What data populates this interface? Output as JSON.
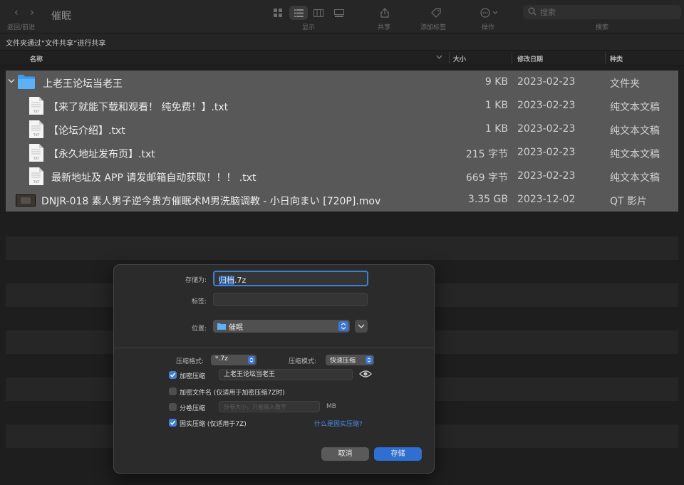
{
  "toolbar": {
    "back_forward_label": "返回/前进",
    "window_title": "催眠",
    "display_label": "显示",
    "share_label": "共享",
    "add_tag_label": "添加标签",
    "action_label": "操作",
    "search_placeholder": "搜索",
    "search_label": "搜索"
  },
  "share_bar": {
    "text": "文件夹通过“文件共享”进行共享"
  },
  "columns": {
    "name": "名称",
    "size": "大小",
    "date": "修改日期",
    "kind": "种类"
  },
  "files": [
    {
      "name": "上老王论坛当老王",
      "size": "9 KB",
      "date": "2023-02-23",
      "kind": "文件夹",
      "icon": "folder-icon",
      "expanded": true
    },
    {
      "name": "【来了就能下载和观看！ 纯免费！】.txt",
      "size": "1 KB",
      "date": "2023-02-23",
      "kind": "纯文本文稿",
      "icon": "txt-file-icon",
      "badge": "TXT"
    },
    {
      "name": "【论坛介绍】.txt",
      "size": "1 KB",
      "date": "2023-02-23",
      "kind": "纯文本文稿",
      "icon": "txt-file-icon",
      "badge": "TXT"
    },
    {
      "name": "【永久地址发布页】.txt",
      "size": "215 字节",
      "date": "2023-02-23",
      "kind": "纯文本文稿",
      "icon": "txt-file-icon",
      "badge": "TXT"
    },
    {
      "name": "最新地址及 APP 请发邮箱自动获取！！！ .txt",
      "size": "669 字节",
      "date": "2023-02-23",
      "kind": "纯文本文稿",
      "icon": "txt-file-icon",
      "badge": "TXT"
    },
    {
      "name": "DNJR-018 素人男子逆今贵方催眠术M男洗脑调教 - 小日向まい [720P].mov",
      "size": "3.35 GB",
      "date": "2023-12-02",
      "kind": "QT 影片",
      "icon": "video-thumbnail-icon"
    }
  ],
  "dialog": {
    "save_as_label": "存储为:",
    "save_as_value": "归档.7z",
    "save_as_selected": "归档",
    "save_as_ext": ".7z",
    "tags_label": "标签:",
    "location_label": "位置:",
    "location_value": "催眠",
    "format_label": "压缩格式:",
    "format_value": "*.7z",
    "mode_label": "压缩模式:",
    "mode_value": "快速压缩",
    "encrypt_label": "加密压缩",
    "encrypt_checked": true,
    "password_value": "上老王论坛当老王",
    "encrypt_names_label": "加密文件名 (仅适用于加密压缩7Z时)",
    "encrypt_names_checked": false,
    "split_label": "分卷压缩",
    "split_checked": false,
    "split_placeholder": "分卷大小，只能输入数字",
    "split_unit": "MB",
    "solid_label": "固实压缩 (仅适用于7Z)",
    "solid_checked": true,
    "solid_help": "什么是固实压缩?",
    "cancel_label": "取消",
    "save_label": "存储"
  },
  "colors": {
    "accent": "#3f7fd6",
    "selection": "#585858",
    "folder": "#3d9cf0"
  }
}
